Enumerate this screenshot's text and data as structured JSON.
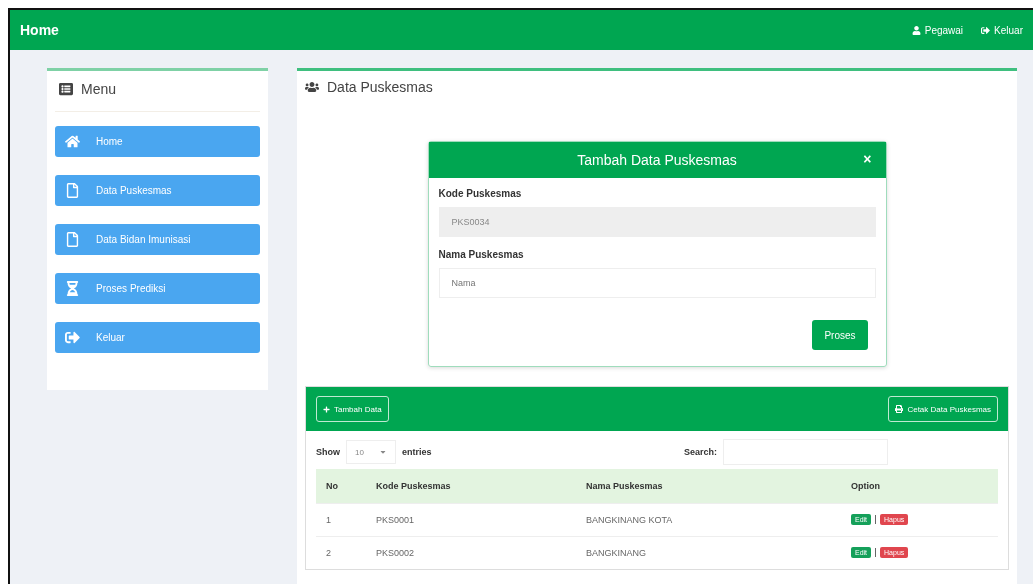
{
  "navbar": {
    "brand": "Home",
    "links": [
      {
        "kind": "user",
        "label": "Pegawai"
      },
      {
        "kind": "logout",
        "label": "Keluar"
      }
    ]
  },
  "sidebar": {
    "title": "Menu",
    "items": [
      {
        "kind": "home",
        "label": "Home"
      },
      {
        "kind": "file",
        "label": "Data Puskesmas"
      },
      {
        "kind": "file",
        "label": "Data Bidan Imunisasi"
      },
      {
        "kind": "hourglass",
        "label": "Proses Prediksi"
      },
      {
        "kind": "logout",
        "label": "Keluar"
      }
    ]
  },
  "panel": {
    "title": "Data Puskesmas"
  },
  "modal": {
    "title": "Tambah Data Puskesmas",
    "close": "×",
    "fields": [
      {
        "label": "Kode Puskesmas",
        "value": "PKS0034",
        "disabled": true
      },
      {
        "label": "Nama Puskesmas",
        "placeholder": "Nama",
        "disabled": false
      }
    ],
    "submit": "Proses"
  },
  "table_box": {
    "add_button": "Tambah Data",
    "print_button": "Cetak Data Puskesmas",
    "show_label": "Show",
    "page_size": "10",
    "entries_label": "entries",
    "search_label": "Search:",
    "columns": [
      "No",
      "Kode Puskesmas",
      "Nama Puskesmas",
      "Option"
    ],
    "rows": [
      {
        "no": "1",
        "kode": "PKS0001",
        "nama": "BANGKINANG KOTA",
        "edit": "Edit",
        "hapus": "Hapus"
      },
      {
        "no": "2",
        "kode": "PKS0002",
        "nama": "BANGKINANG",
        "edit": "Edit",
        "hapus": "Hapus"
      }
    ]
  }
}
